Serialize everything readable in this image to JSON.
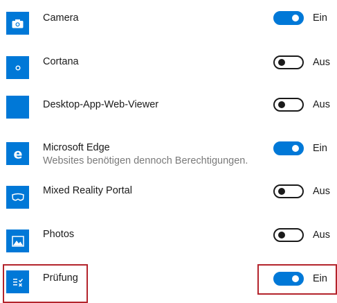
{
  "apps": [
    {
      "name": "Camera",
      "icon": "camera-icon",
      "enabled": true,
      "state_label": "Ein"
    },
    {
      "name": "Cortana",
      "icon": "cortana-icon",
      "enabled": false,
      "state_label": "Aus"
    },
    {
      "name": "Desktop-App-Web-Viewer",
      "icon": "blank-app-icon",
      "enabled": false,
      "state_label": "Aus"
    },
    {
      "name": "Microsoft Edge",
      "subtitle": "Websites benötigen dennoch Berechtigungen.",
      "icon": "edge-icon",
      "enabled": true,
      "state_label": "Ein"
    },
    {
      "name": "Mixed Reality Portal",
      "icon": "mixed-reality-icon",
      "enabled": false,
      "state_label": "Aus"
    },
    {
      "name": "Photos",
      "icon": "photos-icon",
      "enabled": false,
      "state_label": "Aus"
    },
    {
      "name": "Prüfung",
      "icon": "exam-icon",
      "enabled": true,
      "state_label": "Ein"
    }
  ],
  "colors": {
    "accent": "#0078d7",
    "highlight": "#b3232b",
    "text": "#1a1a1a",
    "secondary_text": "#7a7a7a"
  }
}
